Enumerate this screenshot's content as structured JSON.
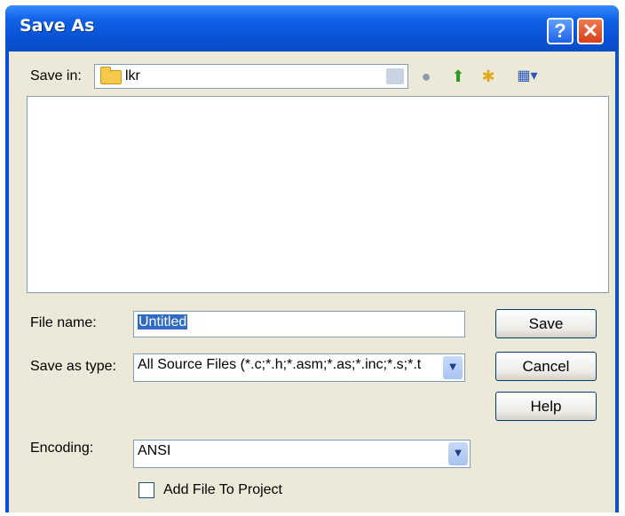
{
  "window": {
    "title": "Save As"
  },
  "titlebar": {
    "help_glyph": "?",
    "close_glyph": "✕"
  },
  "toolbar": {
    "save_in_label": "Save in:",
    "save_in_value": "lkr",
    "back_glyph": "◀",
    "recent_glyph": "●",
    "up_glyph": "⬆",
    "new_folder_glyph": "✱",
    "views_glyph": "▦▾"
  },
  "form": {
    "file_name_label": "File name:",
    "file_name_value": "Untitled",
    "save_as_type_label": "Save as type:",
    "save_as_type_value": "All Source Files (*.c;*.h;*.asm;*.as;*.inc;*.s;*.t",
    "encoding_label": "Encoding:",
    "encoding_value": "ANSI",
    "add_to_project_label": "Add File To Project"
  },
  "buttons": {
    "save": "Save",
    "cancel": "Cancel",
    "help": "Help"
  },
  "icons": {
    "dropdown": "chevron-down-icon"
  }
}
